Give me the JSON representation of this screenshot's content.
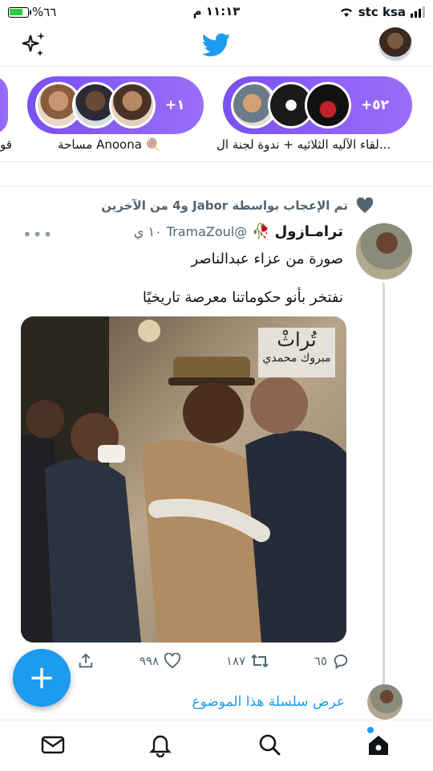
{
  "status_bar": {
    "battery": "%٦٦",
    "time": "١١:١٣ م",
    "carrier": "stc ksa"
  },
  "spaces": [
    {
      "count": "+٥٢",
      "label": "لقاء الآليه الثلاثيه + ندوة لجنة ال..."
    },
    {
      "count": "+١",
      "label": "مساحة Anoona"
    },
    {
      "count": "",
      "label": "قو"
    }
  ],
  "tweet": {
    "social_context": "تم الإعجاب بواسطة Jabor و4 من الآخرين",
    "display_name": "ترامـازول",
    "handle": "@TramaZoul",
    "time": "١٠ ي",
    "line1": "صورة من عزاء عبدالناصر",
    "line2": "نفتخر بأنو حكوماتنا معرصة تاريخيًا",
    "watermark_line1": "تُراثْ",
    "watermark_line2": "مبروك محمدي",
    "replies": "٦٥",
    "retweets": "١٨٧",
    "likes": "٩٩٨"
  },
  "show_thread_label": "عرض سلسلة هذا الموضوع",
  "colors": {
    "accent": "#1d9bf0",
    "spaces_purple": "#7a50f0"
  }
}
